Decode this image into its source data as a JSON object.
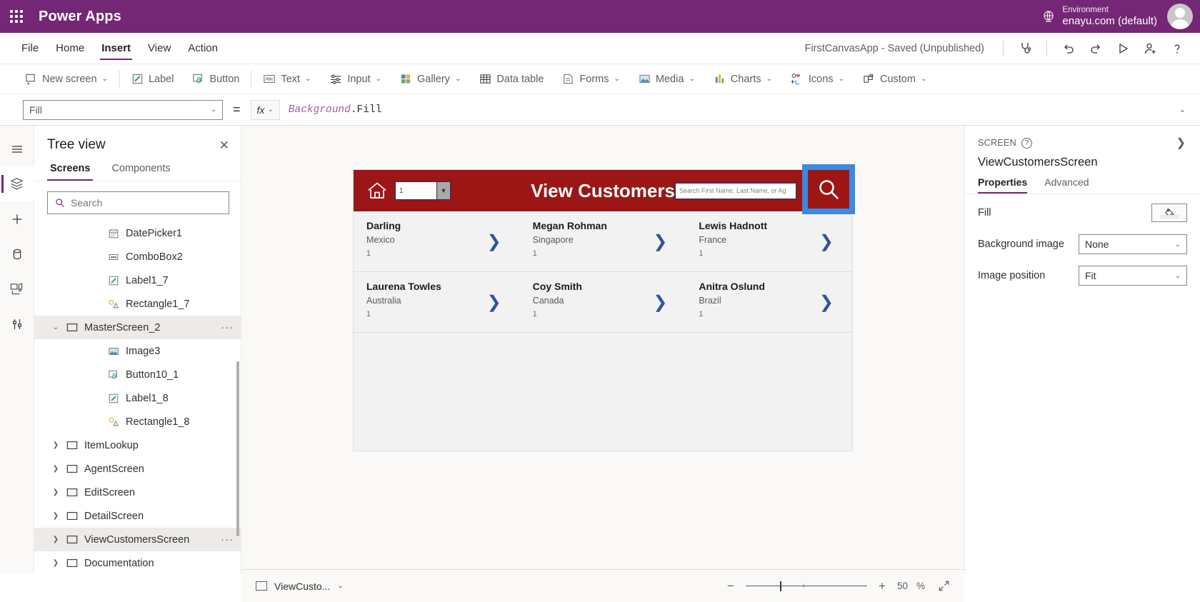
{
  "topbar": {
    "brand": "Power Apps",
    "waffle_icon": "app-launcher-icon",
    "environment_label": "Environment",
    "environment_value": "enayu.com (default)",
    "environment_icon": "globe-icon",
    "avatar_icon": "user-avatar"
  },
  "menubar": {
    "items": [
      {
        "label": "File",
        "active": false
      },
      {
        "label": "Home",
        "active": false
      },
      {
        "label": "Insert",
        "active": true
      },
      {
        "label": "View",
        "active": false
      },
      {
        "label": "Action",
        "active": false
      }
    ],
    "app_status": "FirstCanvasApp - Saved (Unpublished)",
    "actions": [
      {
        "name": "app-checker-icon",
        "title": "App checker"
      },
      {
        "name": "undo-icon",
        "title": "Undo"
      },
      {
        "name": "redo-icon",
        "title": "Redo"
      },
      {
        "name": "preview-icon",
        "title": "Preview the app"
      },
      {
        "name": "share-icon",
        "title": "Share"
      },
      {
        "name": "help-icon",
        "title": "Help"
      }
    ]
  },
  "ribbon": {
    "items": [
      {
        "label": "New screen",
        "icon": "new-screen-icon",
        "caret": true
      },
      {
        "label": "Label",
        "icon": "label-icon",
        "caret": false
      },
      {
        "label": "Button",
        "icon": "button-icon",
        "caret": false
      },
      {
        "label": "Text",
        "icon": "text-icon",
        "caret": true
      },
      {
        "label": "Input",
        "icon": "input-icon",
        "caret": true
      },
      {
        "label": "Gallery",
        "icon": "gallery-icon",
        "caret": true
      },
      {
        "label": "Data table",
        "icon": "data-table-icon",
        "caret": false
      },
      {
        "label": "Forms",
        "icon": "forms-icon",
        "caret": true
      },
      {
        "label": "Media",
        "icon": "media-icon",
        "caret": true
      },
      {
        "label": "Charts",
        "icon": "charts-icon",
        "caret": true
      },
      {
        "label": "Icons",
        "icon": "icons-icon",
        "caret": true
      },
      {
        "label": "Custom",
        "icon": "custom-icon",
        "caret": true
      }
    ]
  },
  "formula_bar": {
    "property_selected": "Fill",
    "equals": "=",
    "fx_label": "fx",
    "formula_object": "Background",
    "formula_member": ".Fill"
  },
  "rail": {
    "items": [
      {
        "name": "hamburger-menu-icon",
        "active": false
      },
      {
        "name": "tree-view-icon",
        "active": true
      },
      {
        "name": "insert-icon",
        "active": false
      },
      {
        "name": "data-icon",
        "active": false
      },
      {
        "name": "media-icon",
        "active": false
      },
      {
        "name": "advanced-tools-icon",
        "active": false
      }
    ]
  },
  "tree_view": {
    "title": "Tree view",
    "close_icon": "close-icon",
    "tabs": [
      {
        "label": "Screens",
        "active": true
      },
      {
        "label": "Components",
        "active": false
      }
    ],
    "search_placeholder": "Search",
    "search_value": "",
    "items": [
      {
        "label": "DatePicker1",
        "icon": "date-picker-icon",
        "indent": 2,
        "chevron": "",
        "selected": false,
        "more": false
      },
      {
        "label": "ComboBox2",
        "icon": "combobox-icon",
        "indent": 2,
        "chevron": "",
        "selected": false,
        "more": false
      },
      {
        "label": "Label1_7",
        "icon": "label-icon",
        "indent": 2,
        "chevron": "",
        "selected": false,
        "more": false
      },
      {
        "label": "Rectangle1_7",
        "icon": "rectangle-icon",
        "indent": 2,
        "chevron": "",
        "selected": false,
        "more": false
      },
      {
        "label": "MasterScreen_2",
        "icon": "screen-icon",
        "indent": 1,
        "chevron": "v",
        "selected": true,
        "more": true
      },
      {
        "label": "Image3",
        "icon": "image-icon",
        "indent": 2,
        "chevron": "",
        "selected": false,
        "more": false
      },
      {
        "label": "Button10_1",
        "icon": "button-icon",
        "indent": 2,
        "chevron": "",
        "selected": false,
        "more": false
      },
      {
        "label": "Label1_8",
        "icon": "label-icon",
        "indent": 2,
        "chevron": "",
        "selected": false,
        "more": false
      },
      {
        "label": "Rectangle1_8",
        "icon": "rectangle-icon",
        "indent": 2,
        "chevron": "",
        "selected": false,
        "more": false
      },
      {
        "label": "ItemLookup",
        "icon": "screen-icon",
        "indent": 1,
        "chevron": ">",
        "selected": false,
        "more": false
      },
      {
        "label": "AgentScreen",
        "icon": "screen-icon",
        "indent": 1,
        "chevron": ">",
        "selected": false,
        "more": false
      },
      {
        "label": "EditScreen",
        "icon": "screen-icon",
        "indent": 1,
        "chevron": ">",
        "selected": false,
        "more": false
      },
      {
        "label": "DetailScreen",
        "icon": "screen-icon",
        "indent": 1,
        "chevron": ">",
        "selected": false,
        "more": false
      },
      {
        "label": "ViewCustomersScreen",
        "icon": "screen-icon",
        "indent": 1,
        "chevron": ">",
        "selected": true,
        "more": true
      },
      {
        "label": "Documentation",
        "icon": "screen-icon",
        "indent": 1,
        "chevron": ">",
        "selected": false,
        "more": false
      }
    ]
  },
  "canvas": {
    "app_header": {
      "home_icon": "home-icon",
      "combo_value": "1",
      "combo_caret_icon": "chevron-down-icon",
      "title": "View Customers",
      "search_placeholder": "Search First Name, Last Name, or Ag",
      "search_value": "",
      "search_button_icon": "search-icon",
      "header_color": "#9c1616",
      "selection_color": "#3c8ade"
    },
    "gallery_rows": [
      [
        {
          "name": "Darling",
          "country": "Mexico",
          "count": "1",
          "chevron_icon": "chevron-right-icon"
        },
        {
          "name": "Megan  Rohman",
          "country": "Singapore",
          "count": "1",
          "chevron_icon": "chevron-right-icon"
        },
        {
          "name": "Lewis  Hadnott",
          "country": "France",
          "count": "1",
          "chevron_icon": "chevron-right-icon"
        }
      ],
      [
        {
          "name": "Laurena  Towles",
          "country": "Australia",
          "count": "1",
          "chevron_icon": "chevron-right-icon"
        },
        {
          "name": "Coy  Smith",
          "country": "Canada",
          "count": "1",
          "chevron_icon": "chevron-right-icon"
        },
        {
          "name": "Anitra  Oslund",
          "country": "Brazil",
          "count": "1",
          "chevron_icon": "chevron-right-icon"
        }
      ]
    ]
  },
  "properties_panel": {
    "kind": "SCREEN",
    "help_icon": "help-circle-icon",
    "expand_icon": "chevron-right-icon",
    "name": "ViewCustomersScreen",
    "tabs": [
      {
        "label": "Properties",
        "active": true
      },
      {
        "label": "Advanced",
        "active": false
      }
    ],
    "rows": [
      {
        "label": "Fill",
        "control": "color",
        "value": "",
        "icon": "paint-bucket-icon"
      },
      {
        "label": "Background image",
        "control": "select",
        "value": "None",
        "icon": "chevron-down-icon"
      },
      {
        "label": "Image position",
        "control": "select",
        "value": "Fit",
        "icon": "chevron-down-icon"
      }
    ]
  },
  "statusbar": {
    "screen_name": "ViewCusto...",
    "screen_caret_icon": "chevron-down-icon",
    "zoom_out_icon": "minus-icon",
    "zoom_in_icon": "plus-icon",
    "zoom_value": "50",
    "zoom_unit": "%",
    "fullscreen_icon": "expand-icon"
  }
}
